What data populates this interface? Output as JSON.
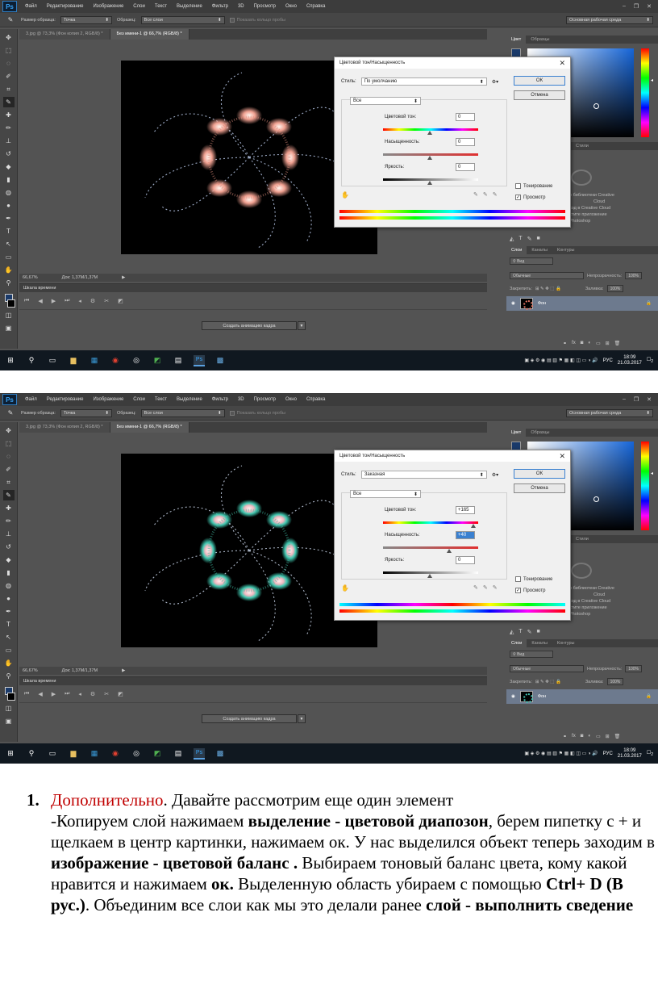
{
  "ui": {
    "app_logo": "Ps",
    "menu": [
      "Файл",
      "Редактирование",
      "Изображение",
      "Слои",
      "Текст",
      "Выделение",
      "Фильтр",
      "3D",
      "Просмотр",
      "Окно",
      "Справка"
    ],
    "options_bar": {
      "sample_size_label": "Размер образца:",
      "sample_size_value": "Точка",
      "sample_label": "Образец:",
      "sample_value": "Все слои",
      "show_ring_label": "Показать кольцо пробы",
      "workspace": "Основная рабочая среда"
    },
    "doc_tabs": [
      "3.jpg @ 73,3% (Фон копия 2, RGB/8) *",
      "Без имени-1 @ 66,7% (RGB/8) *"
    ],
    "status": {
      "zoom": "66,67%",
      "doc": "Док: 1,37M/1,37M"
    },
    "timeline_title": "Шкала времени",
    "create_frames": "Создать анимацию кадра",
    "color_tabs": [
      "Цвет",
      "Образцы"
    ],
    "lib_tabs": [
      "Стили"
    ],
    "lib_lines": [
      "о библиотеки Creative",
      "Cloud",
      "ход в Creative Cloud",
      "стите приложение",
      "Photoshop"
    ],
    "layers_tabs": [
      "Слои",
      "Каналы",
      "Контуры"
    ],
    "layers": {
      "kind": "Вид",
      "blend": "Обычные",
      "opacity_label": "Непрозрачность:",
      "opacity_value": "100%",
      "lock_label": "Закрепить:",
      "fill_label": "Заливка:",
      "fill_value": "100%",
      "layer_name": "Фон"
    },
    "taskbar": {
      "lang": "РУС",
      "time": "18:09",
      "date": "21.03.2017",
      "notif": "2"
    },
    "accent": "#3a80d0"
  },
  "dialogs": [
    {
      "title": "Цветовой тон/Насыщенность",
      "style_label": "Стиль:",
      "style_value": "По умолчанию",
      "channel": "Все",
      "hue_label": "Цветовой тон:",
      "hue_value": "0",
      "sat_label": "Насыщенность:",
      "sat_value": "0",
      "light_label": "Яркость:",
      "light_value": "0",
      "ok": "ОК",
      "cancel": "Отмена",
      "colorize": "Тонирование",
      "preview": "Просмотр"
    },
    {
      "title": "Цветовой тон/Насыщенность",
      "style_label": "Стиль:",
      "style_value": "Заказная",
      "channel": "Все",
      "hue_label": "Цветовой тон:",
      "hue_value": "+165",
      "sat_label": "Насыщенность:",
      "sat_value": "+40",
      "light_label": "Яркость:",
      "light_value": "0",
      "ok": "ОК",
      "cancel": "Отмена",
      "colorize": "Тонирование",
      "preview": "Просмотр"
    }
  ],
  "article": {
    "num": "1.",
    "s1_red": "Дополнительно",
    "s1_rest": ". Давайте рассмотрим еще один элемент",
    "s2a": "-Копируем слой нажимаем ",
    "s2b": "выделение - цветовой диапозон",
    "s2c": ", берем пипетку с + и щелкаем в центр картинки, нажимаем ок. У нас выделился объект теперь заходим в ",
    "s2d": "изображение - цветовой баланс .",
    "s2e": " Выбираем тоновый баланс цвета, кому какой нравится и нажимаем ",
    "s2f": "ок.",
    "s2g": " Выделенную область убираем с помощью ",
    "s2h": "Ctrl+ D (В рус.)",
    "s2i": ". Объединим все слои как мы это делали ранее ",
    "s2j": "слой - выполнить сведение"
  }
}
